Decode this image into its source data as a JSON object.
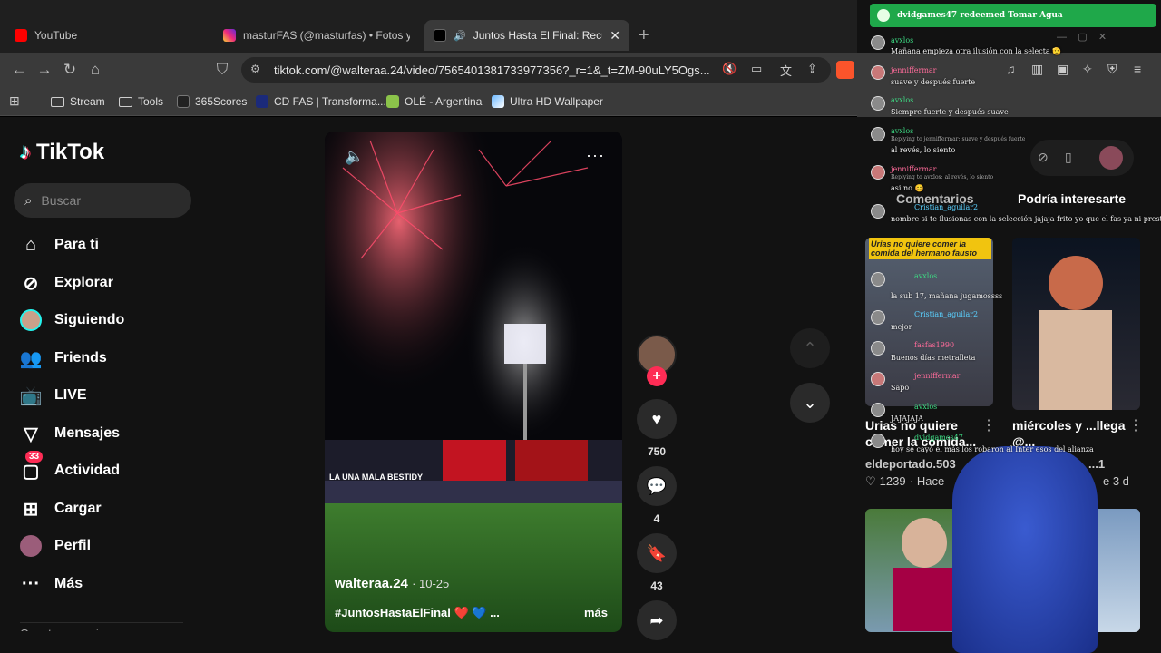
{
  "tabs": [
    {
      "title": "YouTube",
      "color": "#ff0000"
    },
    {
      "title": "masturFAS (@masturfas) • Fotos y vid",
      "color": "#d6249f"
    },
    {
      "title": "Juntos Hasta El Final: Recuerd",
      "color": "#000000"
    }
  ],
  "url": "tiktok.com/@walteraa.24/video/7565401381733977356?_r=1&_t=ZM-90uLY5Ogs...",
  "bookmarks": [
    "Stream",
    "Tools",
    "365Scores",
    "CD FAS | Transforma...",
    "OLÉ - Argentina",
    "Ultra HD Wallpaper"
  ],
  "tiktok": {
    "logo": "TikTok",
    "search_placeholder": "Buscar",
    "nav": [
      {
        "label": "Para ti",
        "icon": "home-icon"
      },
      {
        "label": "Explorar",
        "icon": "compass-icon"
      },
      {
        "label": "Siguiendo",
        "icon": "avatar-icon"
      },
      {
        "label": "Friends",
        "icon": "friends-icon"
      },
      {
        "label": "LIVE",
        "icon": "live-icon"
      },
      {
        "label": "Mensajes",
        "icon": "send-icon"
      },
      {
        "label": "Actividad",
        "icon": "inbox-icon",
        "badge": "33"
      },
      {
        "label": "Cargar",
        "icon": "upload-icon"
      },
      {
        "label": "Perfil",
        "icon": "profile-icon"
      },
      {
        "label": "Más",
        "icon": "more-icon"
      }
    ],
    "footer_cut": "Cuentas que sigues",
    "video": {
      "author": "walteraa.24",
      "date": "· 10-25",
      "caption": "#JuntosHastaElFinal ❤️ 💙 ...",
      "more": "más",
      "banner": "LA UNA MALA BESTIDY",
      "likes": "750",
      "comments": "4",
      "saves": "43"
    },
    "panel_tabs": [
      "Comentarios",
      "Podría interesarte"
    ],
    "suggestions": [
      {
        "title": "Urias no quiere comer la comida...",
        "author": "eldeportado.503",
        "likes": "1239",
        "time": "Hace",
        "overlay": "Urias no quiere comer la comida del hermano fausto"
      },
      {
        "title": "miércoles y ...llega @...",
        "author": "...1",
        "time": "e 3 d"
      }
    ]
  },
  "alert": "dvidgames47 redeemed Tomar Agua",
  "chat": [
    {
      "user": "avxlos",
      "msg": "Mañana empieza otra ilusión con la selecta 🫡"
    },
    {
      "user": "jenniffermar",
      "msg": "suave y después fuerte"
    },
    {
      "user": "avxlos",
      "msg": "Siempre fuerte y después suave"
    },
    {
      "user": "avxlos",
      "reply": "Replying to jenniffermar: suave y después fuerte",
      "msg": "al revés, lo siento"
    },
    {
      "user": "jenniffermar",
      "reply": "Replying to avxlos: al revés, lo siento",
      "msg": "asi no 😊"
    },
    {
      "user": "Cristian_aguilar2",
      "msg": "nombre si te ilusionas con la selección jajaja frito yo que el fas ya ni prestará a Tejada"
    },
    {
      "user": "avxlos",
      "msg": "la sub 17, mañana jugamossss"
    },
    {
      "user": "Cristian_aguilar2",
      "msg": "mejor"
    },
    {
      "user": "fasfas1990",
      "msg": "Buenos días metralleta"
    },
    {
      "user": "jenniffermar",
      "msg": "Sapo"
    },
    {
      "user": "avxlos",
      "msg": "JAJAJAJA"
    },
    {
      "user": "dvidgames47",
      "msg": "hoy se cayó el más los robaron al Inter esos del alianza"
    }
  ]
}
